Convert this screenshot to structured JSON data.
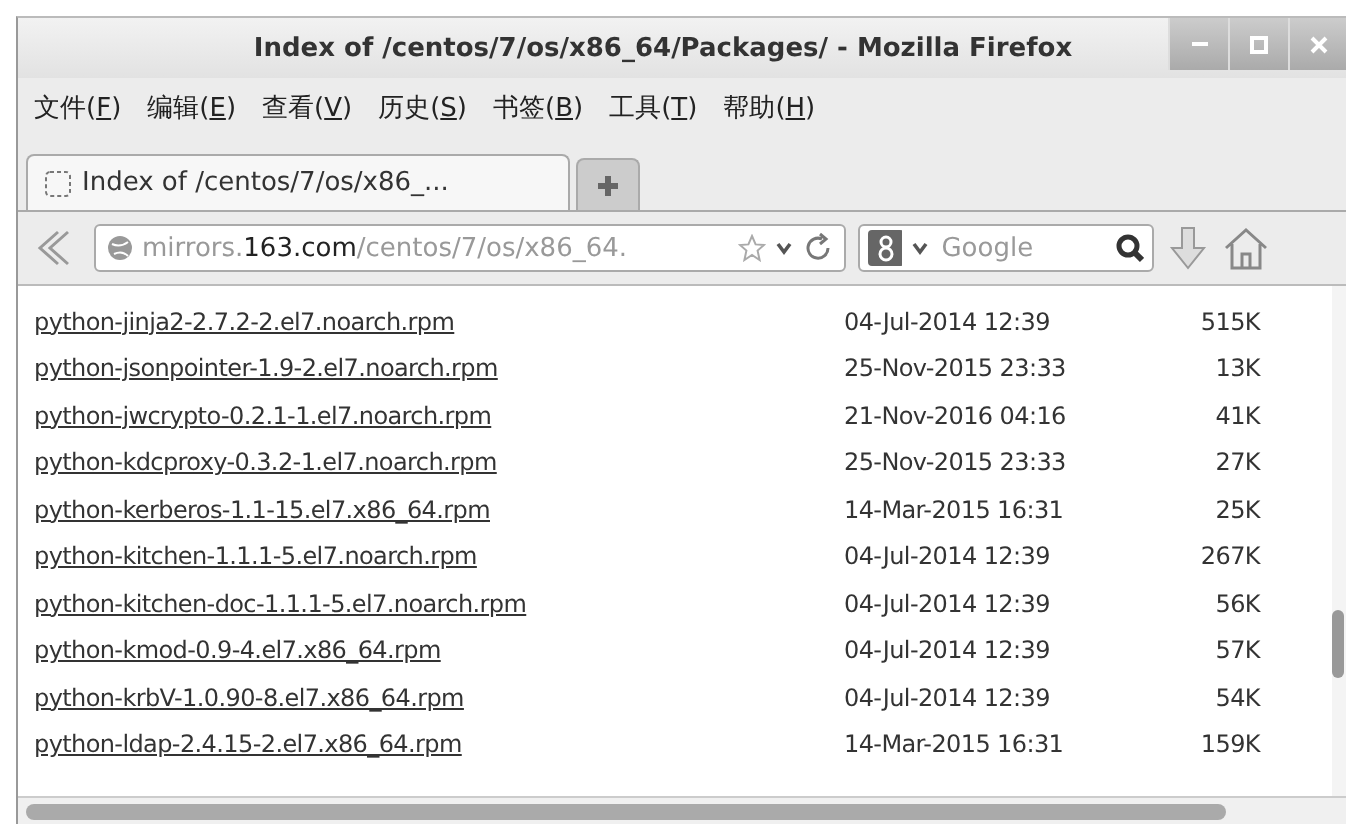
{
  "window": {
    "title": "Index of /centos/7/os/x86_64/Packages/ - Mozilla Firefox"
  },
  "menu": [
    {
      "label": "文件(",
      "key": "F",
      "end": ")"
    },
    {
      "label": "编辑(",
      "key": "E",
      "end": ")"
    },
    {
      "label": "查看(",
      "key": "V",
      "end": ")"
    },
    {
      "label": "历史(",
      "key": "S",
      "end": ")"
    },
    {
      "label": "书签(",
      "key": "B",
      "end": ")"
    },
    {
      "label": "工具(",
      "key": "T",
      "end": ")"
    },
    {
      "label": "帮助(",
      "key": "H",
      "end": ")"
    }
  ],
  "tabs": [
    {
      "label": "Index of /centos/7/os/x86_...",
      "selected": true
    }
  ],
  "address": {
    "host_pre": "mirrors.",
    "host": "163.com",
    "path": "/centos/7/os/x86_64."
  },
  "search": {
    "placeholder": "Google"
  },
  "files": [
    {
      "name": "python-jinja2-2.7.2-2.el7.noarch.rpm",
      "date": "04-Jul-2014 12:39",
      "size": "515K"
    },
    {
      "name": "python-jsonpointer-1.9-2.el7.noarch.rpm",
      "date": "25-Nov-2015 23:33",
      "size": "13K"
    },
    {
      "name": "python-jwcrypto-0.2.1-1.el7.noarch.rpm",
      "date": "21-Nov-2016 04:16",
      "size": "41K"
    },
    {
      "name": "python-kdcproxy-0.3.2-1.el7.noarch.rpm",
      "date": "25-Nov-2015 23:33",
      "size": "27K"
    },
    {
      "name": "python-kerberos-1.1-15.el7.x86_64.rpm",
      "date": "14-Mar-2015 16:31",
      "size": "25K"
    },
    {
      "name": "python-kitchen-1.1.1-5.el7.noarch.rpm",
      "date": "04-Jul-2014 12:39",
      "size": "267K"
    },
    {
      "name": "python-kitchen-doc-1.1.1-5.el7.noarch.rpm",
      "date": "04-Jul-2014 12:39",
      "size": "56K"
    },
    {
      "name": "python-kmod-0.9-4.el7.x86_64.rpm",
      "date": "04-Jul-2014 12:39",
      "size": "57K"
    },
    {
      "name": "python-krbV-1.0.90-8.el7.x86_64.rpm",
      "date": "04-Jul-2014 12:39",
      "size": "54K"
    },
    {
      "name": "python-ldap-2.4.15-2.el7.x86_64.rpm",
      "date": "14-Mar-2015 16:31",
      "size": "159K"
    }
  ]
}
